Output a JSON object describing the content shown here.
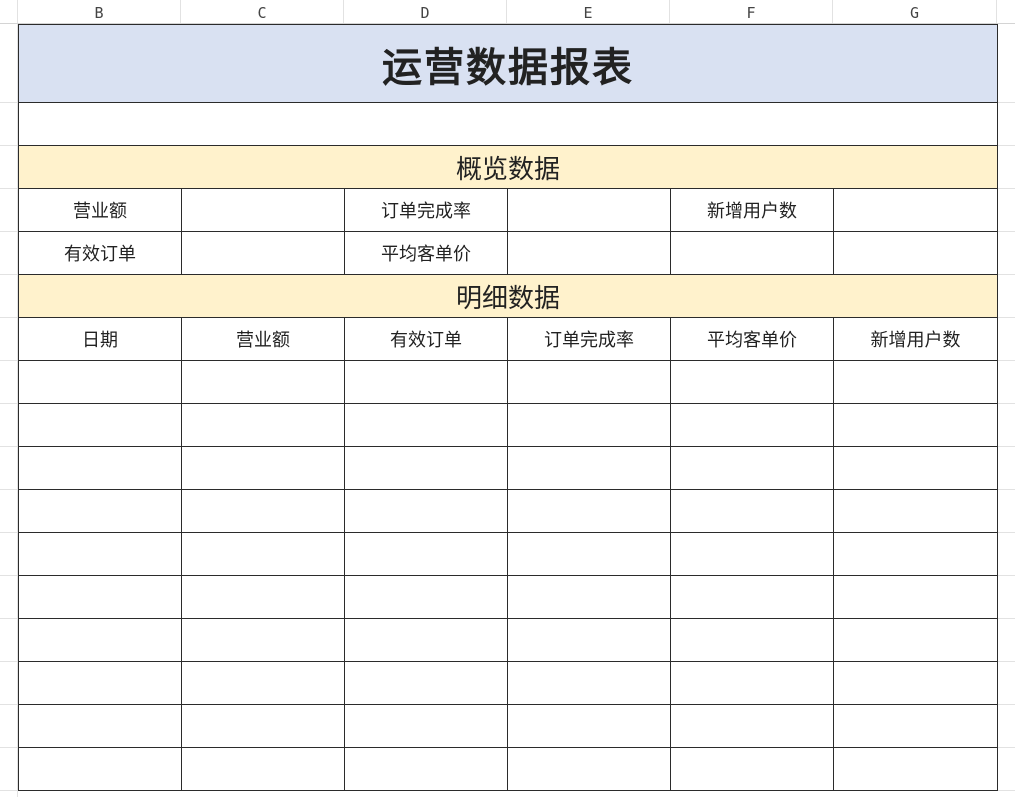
{
  "columns": [
    "B",
    "C",
    "D",
    "E",
    "F",
    "G"
  ],
  "report": {
    "title": "运营数据报表",
    "overview_section": "概览数据",
    "overview": {
      "row1": {
        "label_a": "营业额",
        "value_a": "",
        "label_b": "订单完成率",
        "value_b": "",
        "label_c": "新增用户数",
        "value_c": ""
      },
      "row2": {
        "label_a": "有效订单",
        "value_a": "",
        "label_b": "平均客单价",
        "value_b": "",
        "value_c_label": "",
        "value_c": ""
      }
    },
    "detail_section": "明细数据",
    "detail_headers": [
      "日期",
      "营业额",
      "有效订单",
      "订单完成率",
      "平均客单价",
      "新增用户数"
    ],
    "detail_rows": [
      [
        "",
        "",
        "",
        "",
        "",
        ""
      ],
      [
        "",
        "",
        "",
        "",
        "",
        ""
      ],
      [
        "",
        "",
        "",
        "",
        "",
        ""
      ],
      [
        "",
        "",
        "",
        "",
        "",
        ""
      ],
      [
        "",
        "",
        "",
        "",
        "",
        ""
      ],
      [
        "",
        "",
        "",
        "",
        "",
        ""
      ],
      [
        "",
        "",
        "",
        "",
        "",
        ""
      ],
      [
        "",
        "",
        "",
        "",
        "",
        ""
      ],
      [
        "",
        "",
        "",
        "",
        "",
        ""
      ],
      [
        "",
        "",
        "",
        "",
        "",
        ""
      ]
    ]
  }
}
